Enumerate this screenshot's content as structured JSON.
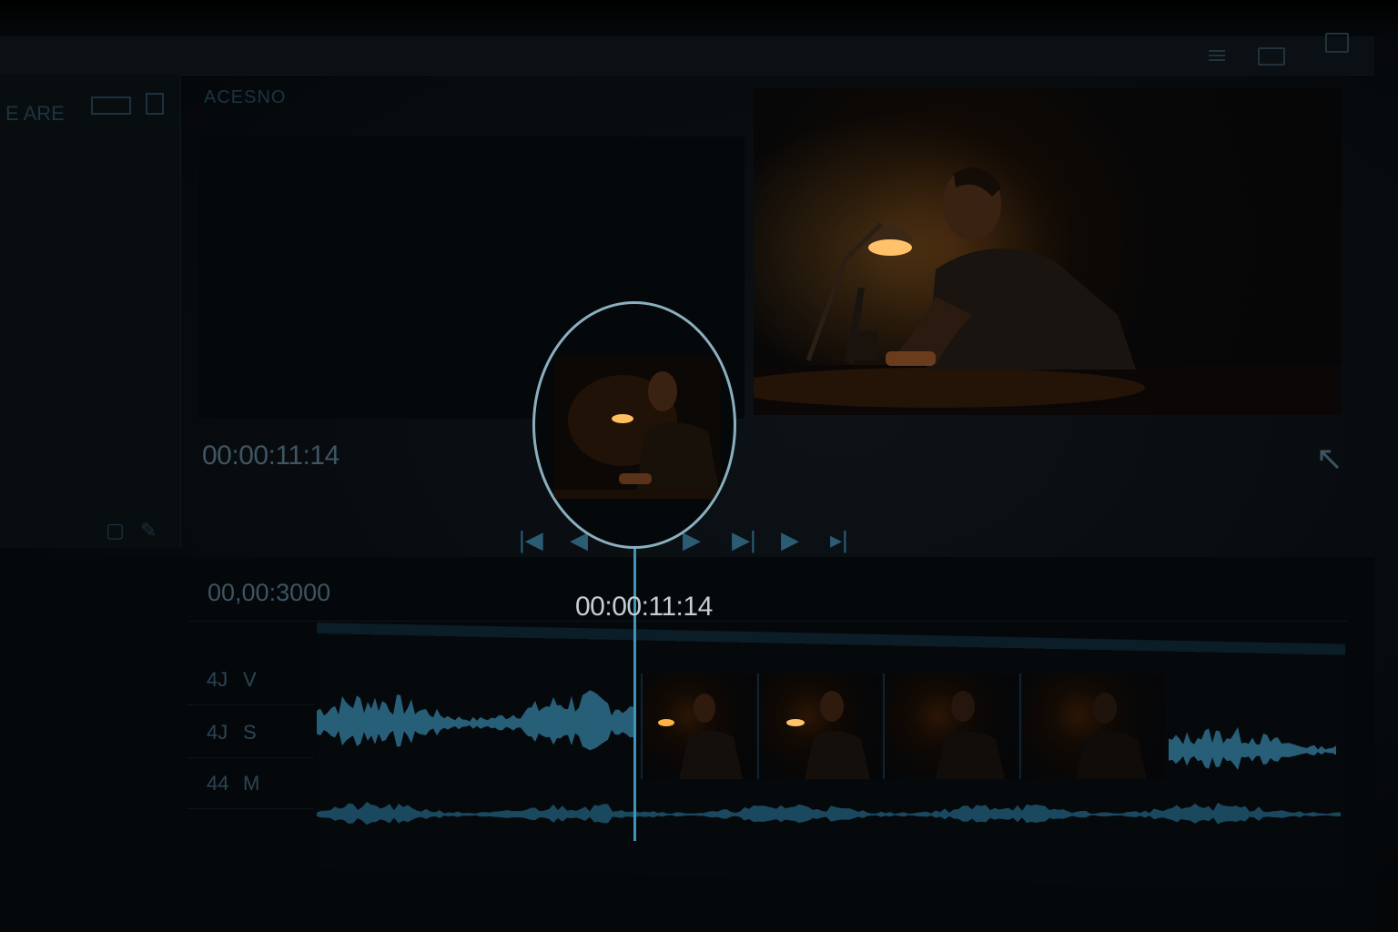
{
  "window": {
    "controls": [
      "menu-icon",
      "maximize-icon",
      "restore-icon"
    ]
  },
  "left_panel": {
    "header_label": "E ARE",
    "icons": [
      "grid-icon",
      "panel-icon"
    ]
  },
  "source_monitor": {
    "tab_label": "ACESNO",
    "timecode": "00:00:11:14"
  },
  "transport": {
    "buttons": [
      "go-to-start-icon",
      "step-back-icon",
      "step-forward-icon",
      "go-to-next-edit-icon",
      "play-icon",
      "go-to-end-icon"
    ]
  },
  "timeline": {
    "ruler_timecode": "00,00:3000",
    "playhead_timecode": "00:00:11:14",
    "tracks": [
      {
        "num": "4J",
        "label": "V"
      },
      {
        "num": "4J",
        "label": "S"
      },
      {
        "num": "44",
        "label": "M"
      }
    ]
  },
  "colors": {
    "accent": "#3f95b8",
    "lamp": "#ffb347",
    "waveform": "#2f6f8c",
    "magnifier_ring": "#8ab0c0"
  }
}
